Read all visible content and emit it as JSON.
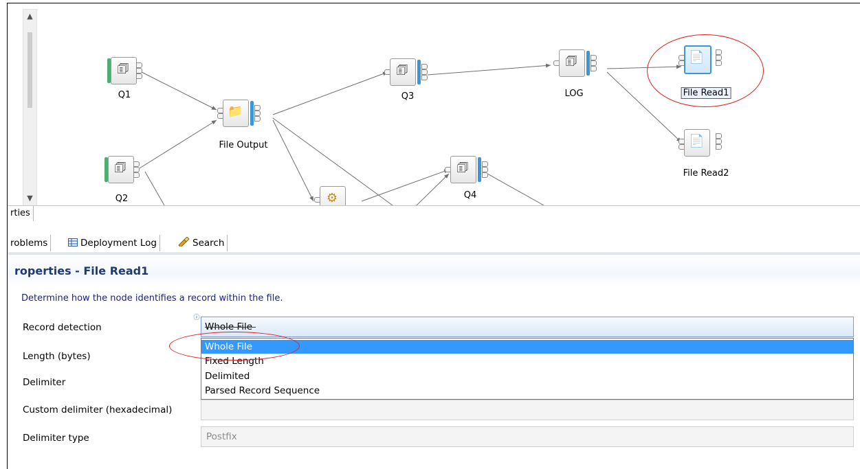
{
  "canvas": {
    "nodes": [
      {
        "id": "q1",
        "label": "Q1"
      },
      {
        "id": "q2",
        "label": "Q2"
      },
      {
        "id": "file_output",
        "label": "File Output"
      },
      {
        "id": "q3",
        "label": "Q3"
      },
      {
        "id": "q4",
        "label": "Q4"
      },
      {
        "id": "log",
        "label": "LOG"
      },
      {
        "id": "file_read1",
        "label": "File Read1"
      },
      {
        "id": "file_read2",
        "label": "File Read2"
      }
    ],
    "connection_color": "#6f6f6f",
    "highlight_color": "#e02020"
  },
  "tabs_top": [
    {
      "label": "rties"
    }
  ],
  "tabs_bottom": [
    {
      "label": "roblems",
      "icon": "problems-icon"
    },
    {
      "label": "Deployment Log",
      "icon": "table-icon"
    },
    {
      "label": "Search",
      "icon": "search-flashlight-icon"
    }
  ],
  "properties": {
    "title": "roperties - File Read1",
    "description": "Determine how the node identifies a record within the file.",
    "labels": {
      "record_detection": "Record detection",
      "length": "Length (bytes)",
      "delimiter": "Delimiter",
      "custom_delimiter": "Custom delimiter (hexadecimal)",
      "delimiter_type": "Delimiter type"
    },
    "record_detection_value": "Whole File",
    "record_detection_options": [
      "Whole File",
      "Fixed Length",
      "Delimited",
      "Parsed Record Sequence"
    ],
    "record_detection_selected": "Whole File",
    "custom_delimiter_value": "",
    "delimiter_type_value": "Postfix"
  }
}
